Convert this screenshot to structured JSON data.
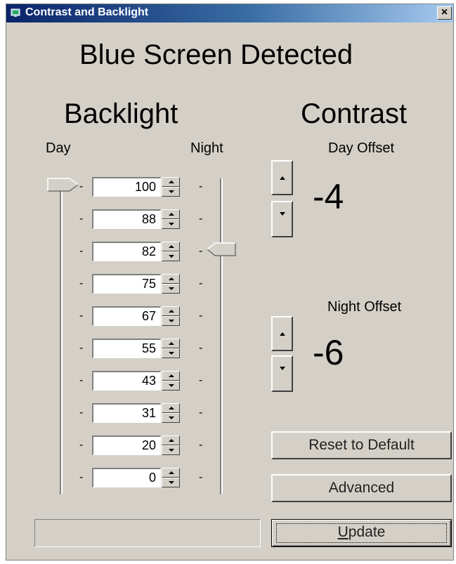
{
  "window": {
    "title": "Contrast and Backlight",
    "close_glyph": "×",
    "icon": "app-icon"
  },
  "status_heading": "Blue Screen Detected",
  "backlight": {
    "heading": "Backlight",
    "day_label": "Day",
    "night_label": "Night",
    "levels": [
      "100",
      "88",
      "82",
      "75",
      "67",
      "55",
      "43",
      "31",
      "20",
      "0"
    ],
    "tick_glyph": "-",
    "day_slider_position_index": 0,
    "night_slider_position_index": 2
  },
  "contrast": {
    "heading": "Contrast",
    "day_offset_label": "Day Offset",
    "day_offset_value": "-4",
    "night_offset_label": "Night Offset",
    "night_offset_value": "-6"
  },
  "buttons": {
    "reset": "Reset to Default",
    "advanced": "Advanced",
    "update": "Update"
  },
  "colors": {
    "face": "#d4d0c8",
    "title_start": "#0a246a",
    "title_end": "#a6caf0"
  }
}
